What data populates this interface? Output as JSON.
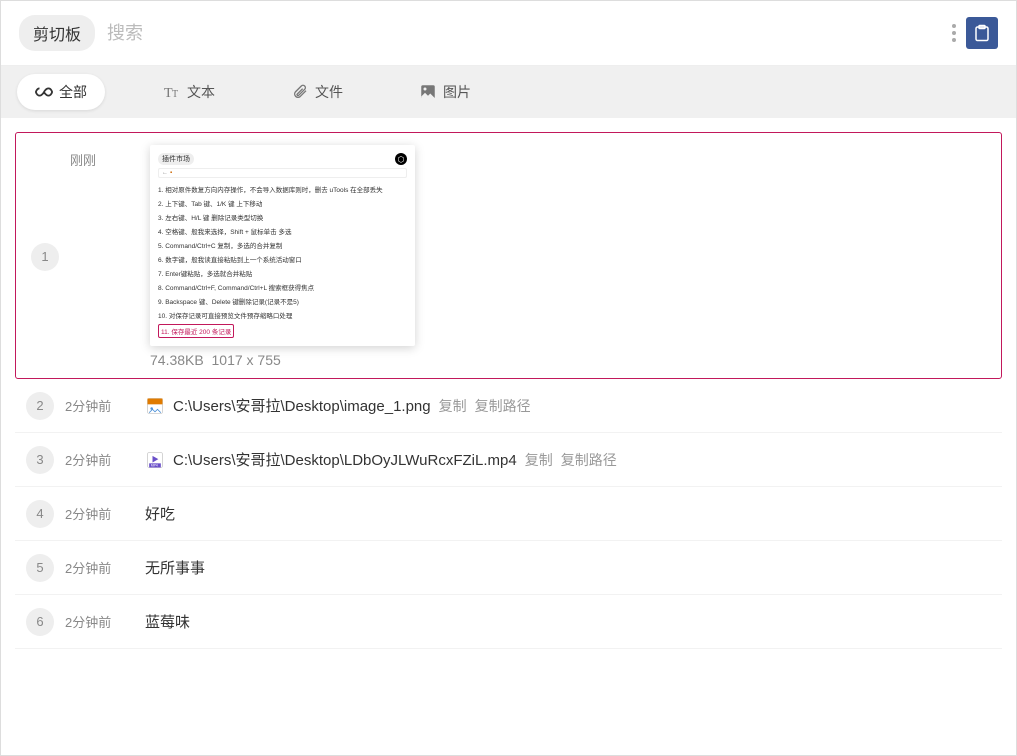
{
  "header": {
    "app_name": "剪切板",
    "search_placeholder": "搜索"
  },
  "tabs": [
    {
      "id": "all",
      "label": "全部",
      "icon": "infinity"
    },
    {
      "id": "text",
      "label": "文本",
      "icon": "text"
    },
    {
      "id": "file",
      "label": "文件",
      "icon": "attach"
    },
    {
      "id": "image",
      "label": "图片",
      "icon": "image"
    }
  ],
  "active_tab": "all",
  "items": [
    {
      "index": "1",
      "time": "刚刚",
      "type": "image",
      "size": "74.38KB",
      "dimensions": "1017 x 755",
      "selected": true,
      "preview": {
        "title": "插件市场",
        "url_text": "",
        "lines": [
          "1. 相对原件数复方向内存操作，不会导入数据库则时，删去 uTools 在全部丢失",
          "2. 上下键、Tab 键、1/K 键 上下移动",
          "3. 左右键、H/L 键 删除记录类型切换",
          "4. 空格键、般我来选择，Shift + 鼠标单击 多选",
          "5. Command/Ctrl+C 复制，多选的合并复制",
          "6. 数字键，般我读直接粘贴到上一个系统活动窗口",
          "7. Enter键粘贴，多选就合并粘贴",
          "8. Command/Ctrl+F, Command/Ctrl+L 搜索框获得焦点",
          "9. Backspace 键、Delete 键删除记录(记录不是5)",
          "10. 对保存记录可直接预览文件预存缩略口处理"
        ],
        "highlight_line": "11. 保存最近 200 条记录"
      }
    },
    {
      "index": "2",
      "time": "2分钟前",
      "type": "file",
      "file_kind": "png",
      "path": "C:\\Users\\安哥拉\\Desktop\\image_1.png",
      "copy_label": "复制",
      "copy_path_label": "复制路径"
    },
    {
      "index": "3",
      "time": "2分钟前",
      "type": "file",
      "file_kind": "mp4",
      "path": "C:\\Users\\安哥拉\\Desktop\\LDbOyJLWuRcxFZiL.mp4",
      "copy_label": "复制",
      "copy_path_label": "复制路径"
    },
    {
      "index": "4",
      "time": "2分钟前",
      "type": "text",
      "text": "好吃"
    },
    {
      "index": "5",
      "time": "2分钟前",
      "type": "text",
      "text": "无所事事"
    },
    {
      "index": "6",
      "time": "2分钟前",
      "type": "text",
      "text": "蓝莓味"
    }
  ]
}
